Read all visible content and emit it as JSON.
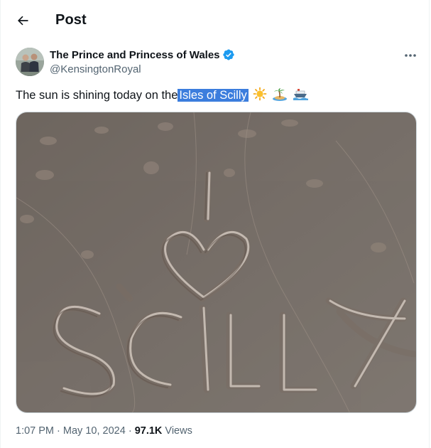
{
  "header": {
    "title": "Post",
    "back_icon": "arrow-left-icon"
  },
  "post": {
    "author": {
      "display_name": "The Prince and Princess of Wales",
      "handle": "@KensingtonRoyal",
      "verified_icon": "verified-badge-icon",
      "verified_color": "#1d9bf0"
    },
    "more_icon": "more-horizontal-icon",
    "text": {
      "before": "The sun is shining today on the",
      "highlight": "Isles of Scilly",
      "emojis": [
        "sun-emoji",
        "palm-island-emoji",
        "ship-emoji"
      ]
    },
    "media": {
      "kind": "photo",
      "words_in_sand": "SCILLY"
    },
    "meta": {
      "time": "1:07 PM",
      "separator": "·",
      "date": "May 10, 2024",
      "views_count": "97.1K",
      "views_label": "Views"
    }
  },
  "colors": {
    "text": "#0f1419",
    "secondary": "#536471",
    "highlight": "#3b7ddd",
    "accent": "#1d9bf0"
  }
}
